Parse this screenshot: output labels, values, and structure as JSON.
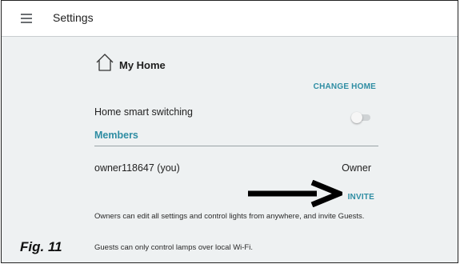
{
  "appbar": {
    "title": "Settings",
    "menu_icon": "hamburger-menu-icon"
  },
  "home": {
    "icon": "home-outline-icon",
    "title": "My Home",
    "change_label": "CHANGE HOME"
  },
  "smart_switching": {
    "label": "Home smart switching",
    "enabled": false
  },
  "members": {
    "header": "Members",
    "items": [
      {
        "name": "owner118647 (you)",
        "role": "Owner"
      }
    ],
    "invite_label": "INVITE"
  },
  "info": {
    "owners_text": "Owners can edit all settings and control lights from anywhere, and invite Guests.",
    "guests_text": "Guests can only control lamps over local Wi-Fi."
  },
  "annotation": {
    "figure_label": "Fig. 11",
    "arrow_icon": "right-arrow-annotation"
  },
  "colors": {
    "accent": "#2e8da3",
    "background": "#eef1f2",
    "appbar": "#ffffff"
  }
}
